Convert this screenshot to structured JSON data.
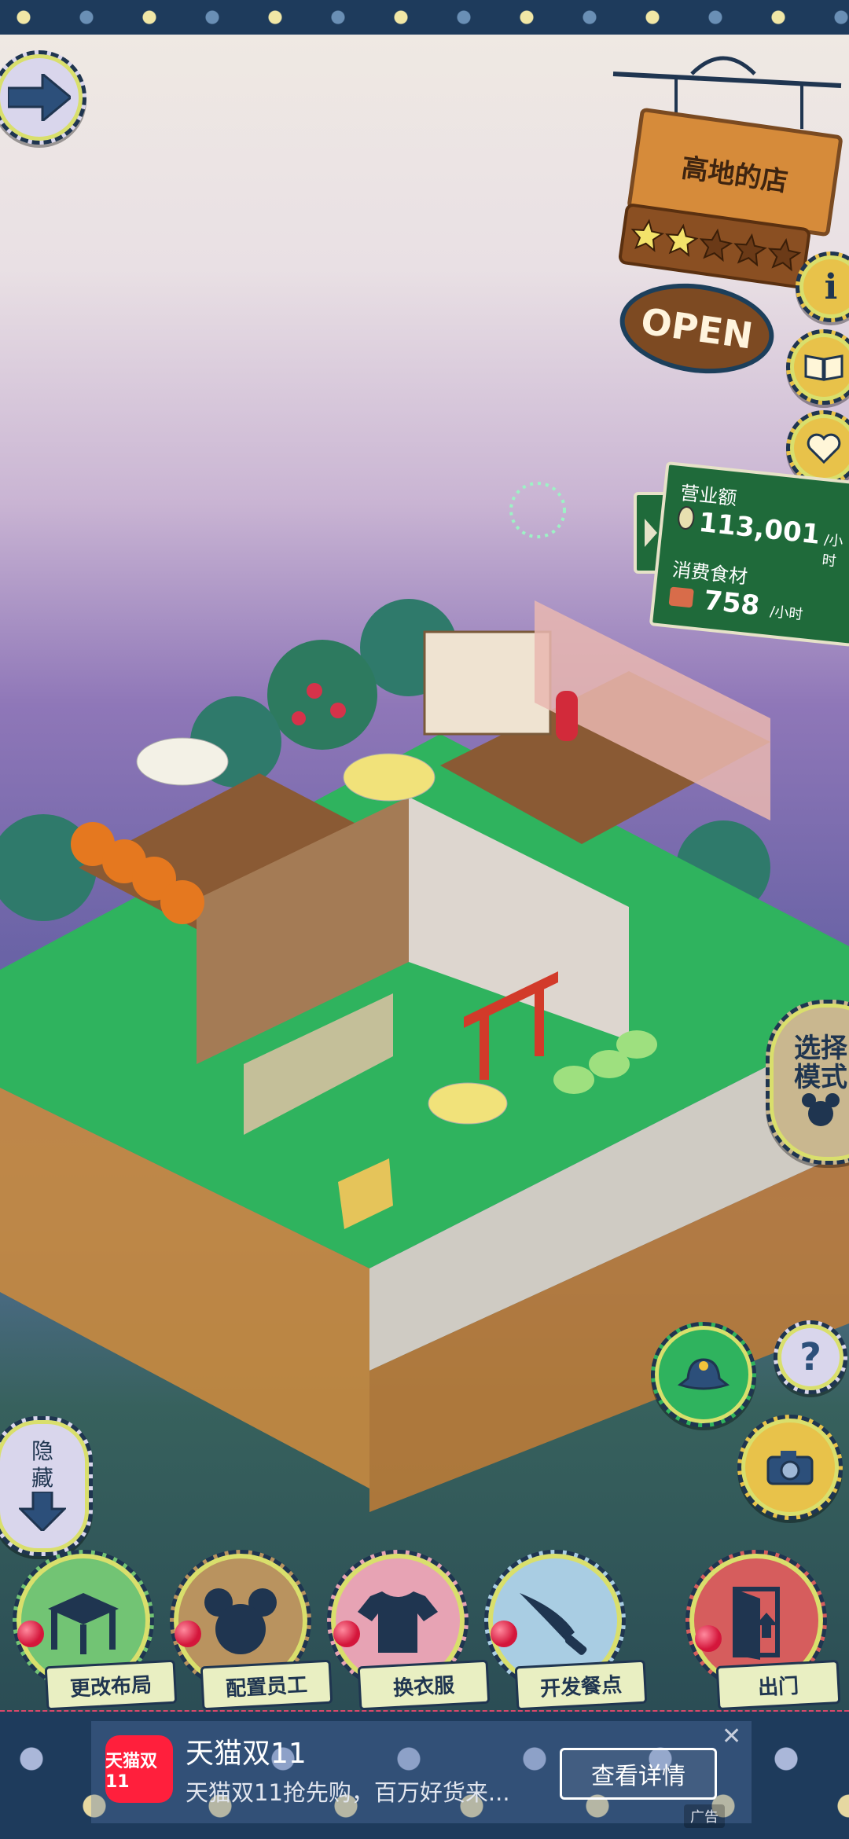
{
  "shop": {
    "name": "高地的店",
    "status": "OPEN",
    "stars_filled": 2,
    "stars_total": 5
  },
  "stats": {
    "revenue_label": "营业额",
    "revenue_value": "113,001",
    "revenue_unit": "/小时",
    "ingredients_label": "消费食材",
    "ingredients_value": "758",
    "ingredients_unit": "/小时"
  },
  "side": {
    "select_mode_label": "选择\n模式",
    "hide_label": "隐\n藏",
    "help_symbol": "?"
  },
  "bottom_nav": [
    {
      "label": "更改布局"
    },
    {
      "label": "配置员工"
    },
    {
      "label": "换衣服"
    },
    {
      "label": "开发餐点"
    },
    {
      "label": "出门"
    }
  ],
  "ad": {
    "logo_text": "天猫双11",
    "title": "天猫双11",
    "subtitle": "天猫双11抢先购，百万好货来...",
    "button": "查看详情",
    "close": "✕",
    "tag": "广告"
  },
  "colors": {
    "accent_yellow": "#d9df6c",
    "navy": "#1f3550",
    "wood": "#d68b3a",
    "board_green": "#1f6a3a",
    "ad_red": "#ff1f3c"
  }
}
